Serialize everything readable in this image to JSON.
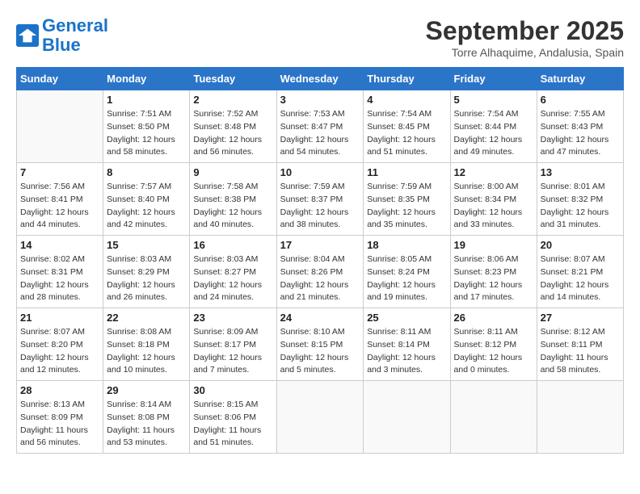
{
  "header": {
    "logo_line1": "General",
    "logo_line2": "Blue",
    "month": "September 2025",
    "location": "Torre Alhaquime, Andalusia, Spain"
  },
  "days_of_week": [
    "Sunday",
    "Monday",
    "Tuesday",
    "Wednesday",
    "Thursday",
    "Friday",
    "Saturday"
  ],
  "weeks": [
    [
      {
        "day": "",
        "info": ""
      },
      {
        "day": "1",
        "info": "Sunrise: 7:51 AM\nSunset: 8:50 PM\nDaylight: 12 hours\nand 58 minutes."
      },
      {
        "day": "2",
        "info": "Sunrise: 7:52 AM\nSunset: 8:48 PM\nDaylight: 12 hours\nand 56 minutes."
      },
      {
        "day": "3",
        "info": "Sunrise: 7:53 AM\nSunset: 8:47 PM\nDaylight: 12 hours\nand 54 minutes."
      },
      {
        "day": "4",
        "info": "Sunrise: 7:54 AM\nSunset: 8:45 PM\nDaylight: 12 hours\nand 51 minutes."
      },
      {
        "day": "5",
        "info": "Sunrise: 7:54 AM\nSunset: 8:44 PM\nDaylight: 12 hours\nand 49 minutes."
      },
      {
        "day": "6",
        "info": "Sunrise: 7:55 AM\nSunset: 8:43 PM\nDaylight: 12 hours\nand 47 minutes."
      }
    ],
    [
      {
        "day": "7",
        "info": "Sunrise: 7:56 AM\nSunset: 8:41 PM\nDaylight: 12 hours\nand 44 minutes."
      },
      {
        "day": "8",
        "info": "Sunrise: 7:57 AM\nSunset: 8:40 PM\nDaylight: 12 hours\nand 42 minutes."
      },
      {
        "day": "9",
        "info": "Sunrise: 7:58 AM\nSunset: 8:38 PM\nDaylight: 12 hours\nand 40 minutes."
      },
      {
        "day": "10",
        "info": "Sunrise: 7:59 AM\nSunset: 8:37 PM\nDaylight: 12 hours\nand 38 minutes."
      },
      {
        "day": "11",
        "info": "Sunrise: 7:59 AM\nSunset: 8:35 PM\nDaylight: 12 hours\nand 35 minutes."
      },
      {
        "day": "12",
        "info": "Sunrise: 8:00 AM\nSunset: 8:34 PM\nDaylight: 12 hours\nand 33 minutes."
      },
      {
        "day": "13",
        "info": "Sunrise: 8:01 AM\nSunset: 8:32 PM\nDaylight: 12 hours\nand 31 minutes."
      }
    ],
    [
      {
        "day": "14",
        "info": "Sunrise: 8:02 AM\nSunset: 8:31 PM\nDaylight: 12 hours\nand 28 minutes."
      },
      {
        "day": "15",
        "info": "Sunrise: 8:03 AM\nSunset: 8:29 PM\nDaylight: 12 hours\nand 26 minutes."
      },
      {
        "day": "16",
        "info": "Sunrise: 8:03 AM\nSunset: 8:27 PM\nDaylight: 12 hours\nand 24 minutes."
      },
      {
        "day": "17",
        "info": "Sunrise: 8:04 AM\nSunset: 8:26 PM\nDaylight: 12 hours\nand 21 minutes."
      },
      {
        "day": "18",
        "info": "Sunrise: 8:05 AM\nSunset: 8:24 PM\nDaylight: 12 hours\nand 19 minutes."
      },
      {
        "day": "19",
        "info": "Sunrise: 8:06 AM\nSunset: 8:23 PM\nDaylight: 12 hours\nand 17 minutes."
      },
      {
        "day": "20",
        "info": "Sunrise: 8:07 AM\nSunset: 8:21 PM\nDaylight: 12 hours\nand 14 minutes."
      }
    ],
    [
      {
        "day": "21",
        "info": "Sunrise: 8:07 AM\nSunset: 8:20 PM\nDaylight: 12 hours\nand 12 minutes."
      },
      {
        "day": "22",
        "info": "Sunrise: 8:08 AM\nSunset: 8:18 PM\nDaylight: 12 hours\nand 10 minutes."
      },
      {
        "day": "23",
        "info": "Sunrise: 8:09 AM\nSunset: 8:17 PM\nDaylight: 12 hours\nand 7 minutes."
      },
      {
        "day": "24",
        "info": "Sunrise: 8:10 AM\nSunset: 8:15 PM\nDaylight: 12 hours\nand 5 minutes."
      },
      {
        "day": "25",
        "info": "Sunrise: 8:11 AM\nSunset: 8:14 PM\nDaylight: 12 hours\nand 3 minutes."
      },
      {
        "day": "26",
        "info": "Sunrise: 8:11 AM\nSunset: 8:12 PM\nDaylight: 12 hours\nand 0 minutes."
      },
      {
        "day": "27",
        "info": "Sunrise: 8:12 AM\nSunset: 8:11 PM\nDaylight: 11 hours\nand 58 minutes."
      }
    ],
    [
      {
        "day": "28",
        "info": "Sunrise: 8:13 AM\nSunset: 8:09 PM\nDaylight: 11 hours\nand 56 minutes."
      },
      {
        "day": "29",
        "info": "Sunrise: 8:14 AM\nSunset: 8:08 PM\nDaylight: 11 hours\nand 53 minutes."
      },
      {
        "day": "30",
        "info": "Sunrise: 8:15 AM\nSunset: 8:06 PM\nDaylight: 11 hours\nand 51 minutes."
      },
      {
        "day": "",
        "info": ""
      },
      {
        "day": "",
        "info": ""
      },
      {
        "day": "",
        "info": ""
      },
      {
        "day": "",
        "info": ""
      }
    ]
  ]
}
